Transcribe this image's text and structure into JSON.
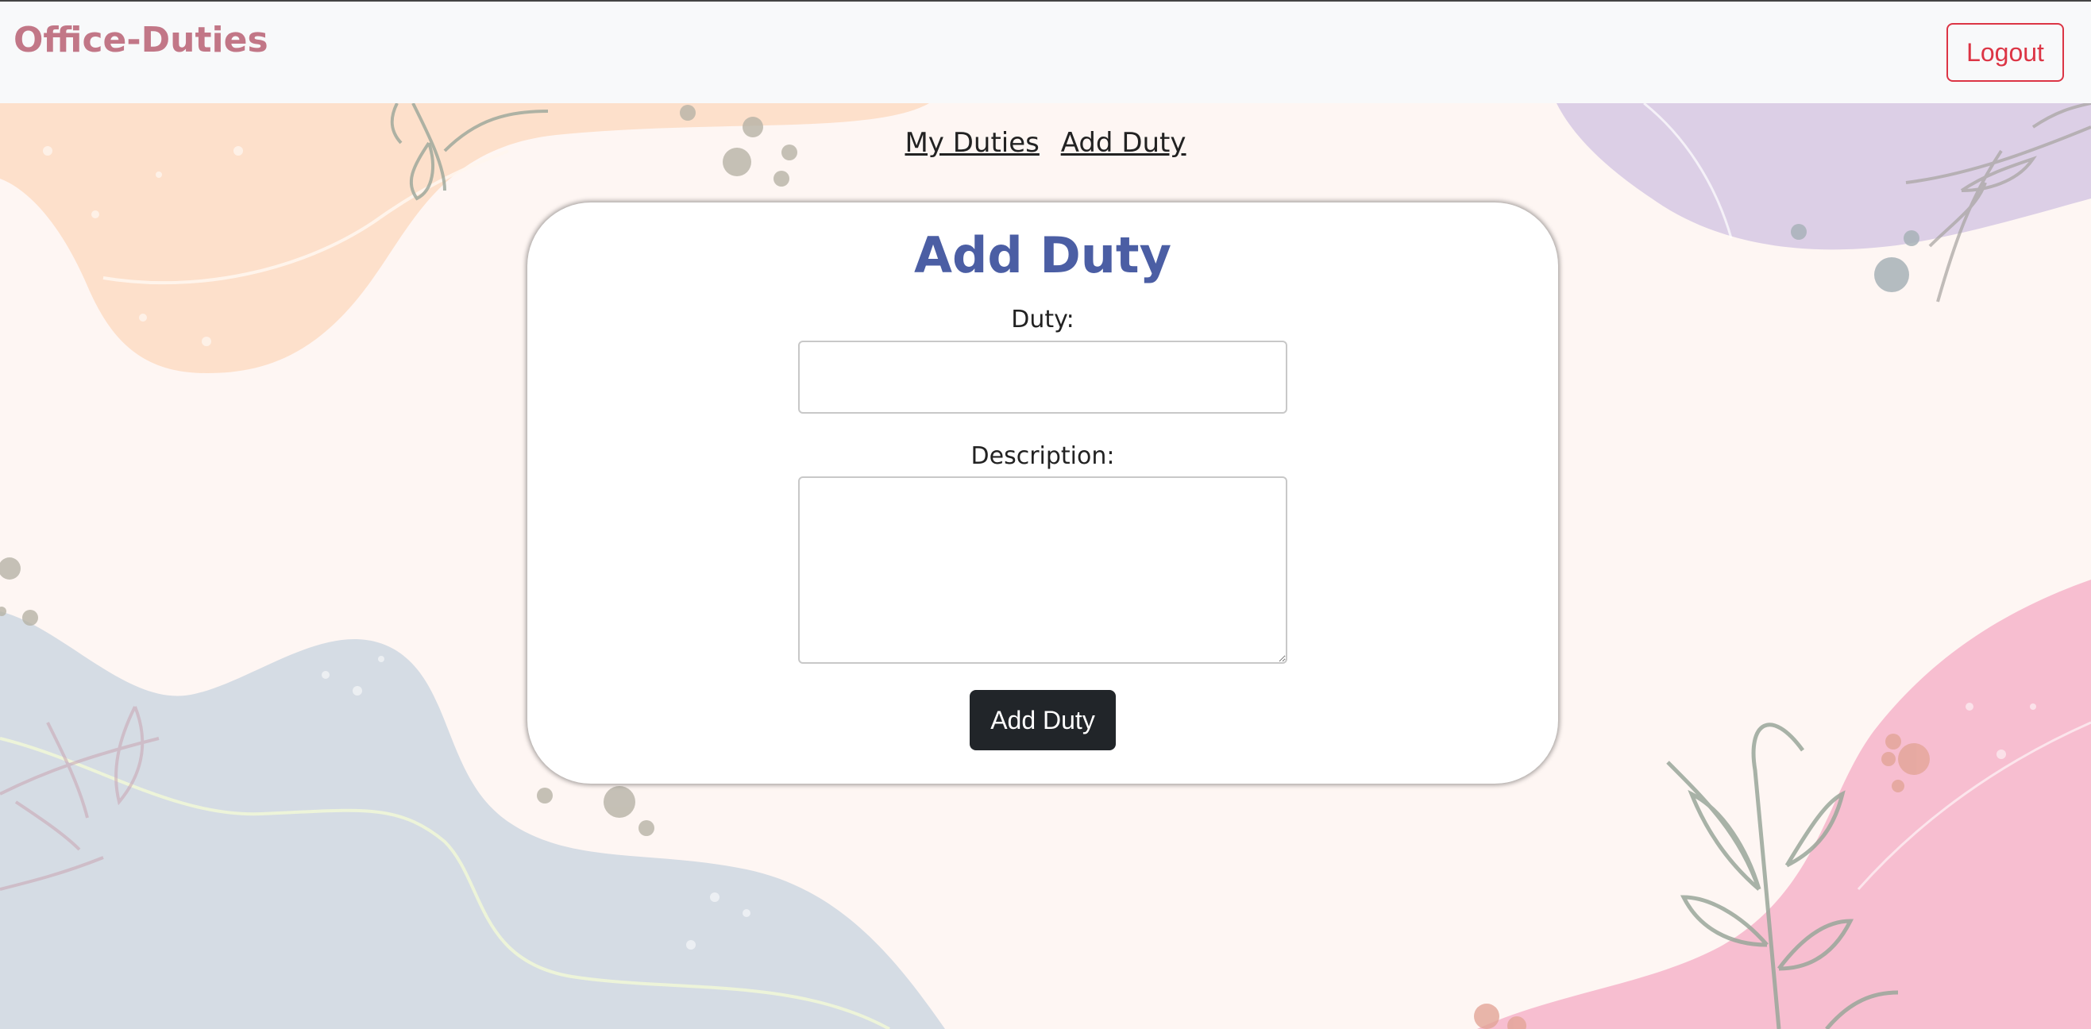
{
  "navbar": {
    "brand": "Office-Duties",
    "logout_label": "Logout"
  },
  "page_nav": {
    "links": [
      {
        "label": "My Duties"
      },
      {
        "label": "Add Duty"
      }
    ]
  },
  "form": {
    "title": "Add Duty",
    "duty_label": "Duty:",
    "duty_value": "",
    "description_label": "Description:",
    "description_value": "",
    "submit_label": "Add Duty"
  },
  "colors": {
    "brand": "#c27787",
    "logout": "#dc3545",
    "title": "#4b5ea4",
    "submit_bg": "#212529",
    "blob_peach": "#fddcc3",
    "blob_lavender": "#dccfe6",
    "blob_blue_gray": "#d5dce4",
    "blob_pink": "#f7bed0",
    "page_bg": "#fef6f3"
  },
  "icons": [
    "leaf-sprig-icon",
    "paint-dot-icon"
  ]
}
